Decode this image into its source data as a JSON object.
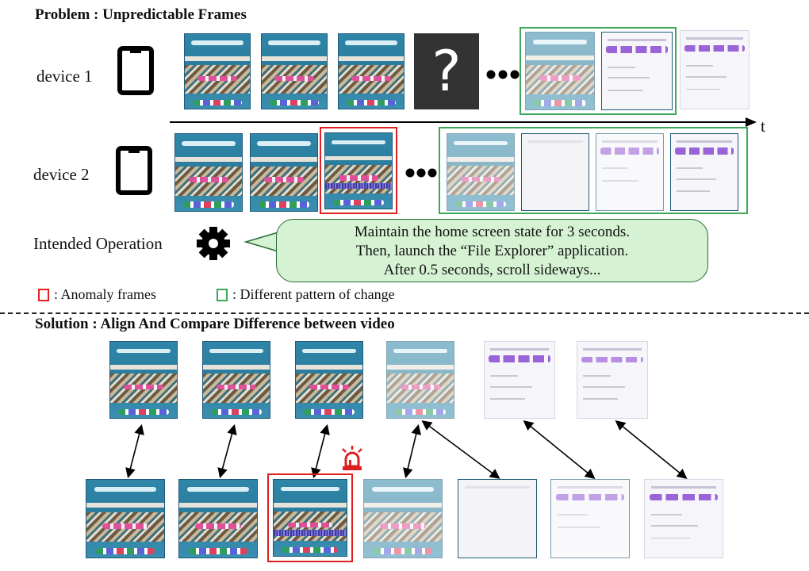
{
  "problem": {
    "title": "Problem : Unpredictable Frames",
    "device1_label": "device 1",
    "device2_label": "device 2",
    "time_axis_label": "t",
    "unknown_frame_symbol": "?",
    "intended_operation": {
      "label": "Intended Operation",
      "lines": [
        "Maintain the home screen state for 3 seconds.",
        "Then, launch the “File Explorer” application.",
        "After 0.5 seconds, scroll sideways..."
      ]
    },
    "legend": {
      "anomaly": ": Anomaly frames",
      "pattern": ": Different pattern of change"
    }
  },
  "solution": {
    "title": "Solution : Align And Compare Difference between video"
  },
  "colors": {
    "anomaly": "#e02020",
    "pattern": "#3aa857",
    "bubble_fill": "#d5f2d2",
    "alarm": "#e02020"
  },
  "icons": {
    "device": "tablet-icon",
    "operation": "gear-icon",
    "alarm": "siren-icon"
  }
}
